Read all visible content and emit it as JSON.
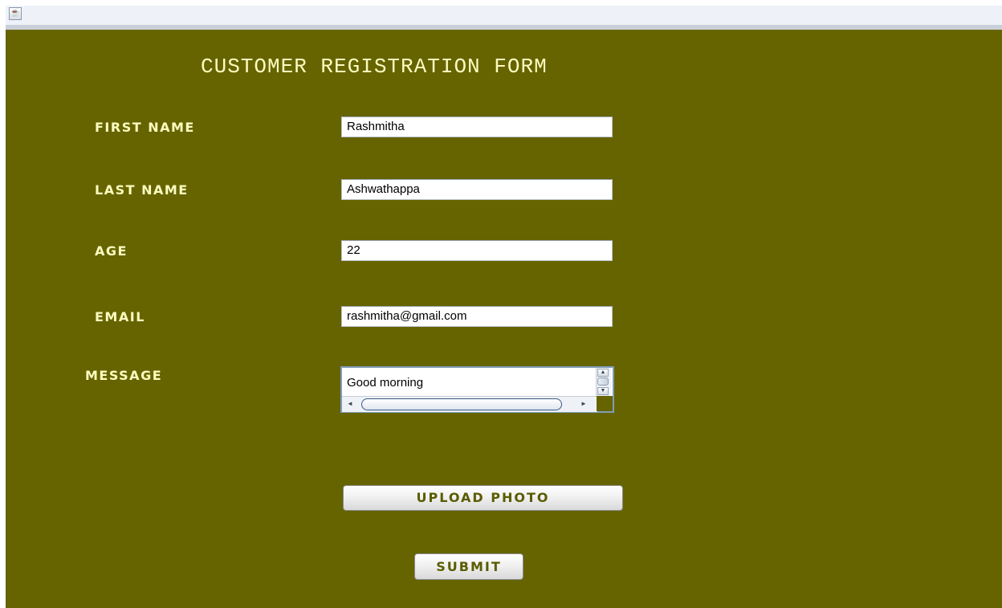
{
  "window": {
    "icon": "java-cup-icon"
  },
  "form": {
    "title": "CUSTOMER REGISTRATION FORM",
    "fields": {
      "first_name": {
        "label": "FIRST NAME",
        "value": "Rashmitha"
      },
      "last_name": {
        "label": "LAST NAME",
        "value": "Ashwathappa"
      },
      "age": {
        "label": "AGE",
        "value": "22"
      },
      "email": {
        "label": "EMAIL",
        "value": "rashmitha@gmail.com"
      },
      "message": {
        "label": "MESSAGE",
        "value": "Good morning"
      }
    },
    "upload_label": "UPLOAD PHOTO",
    "submit_label": "SUBMIT"
  },
  "colors": {
    "background": "#666400",
    "label_text": "#fcfcc0",
    "button_text": "#5a5c00"
  }
}
